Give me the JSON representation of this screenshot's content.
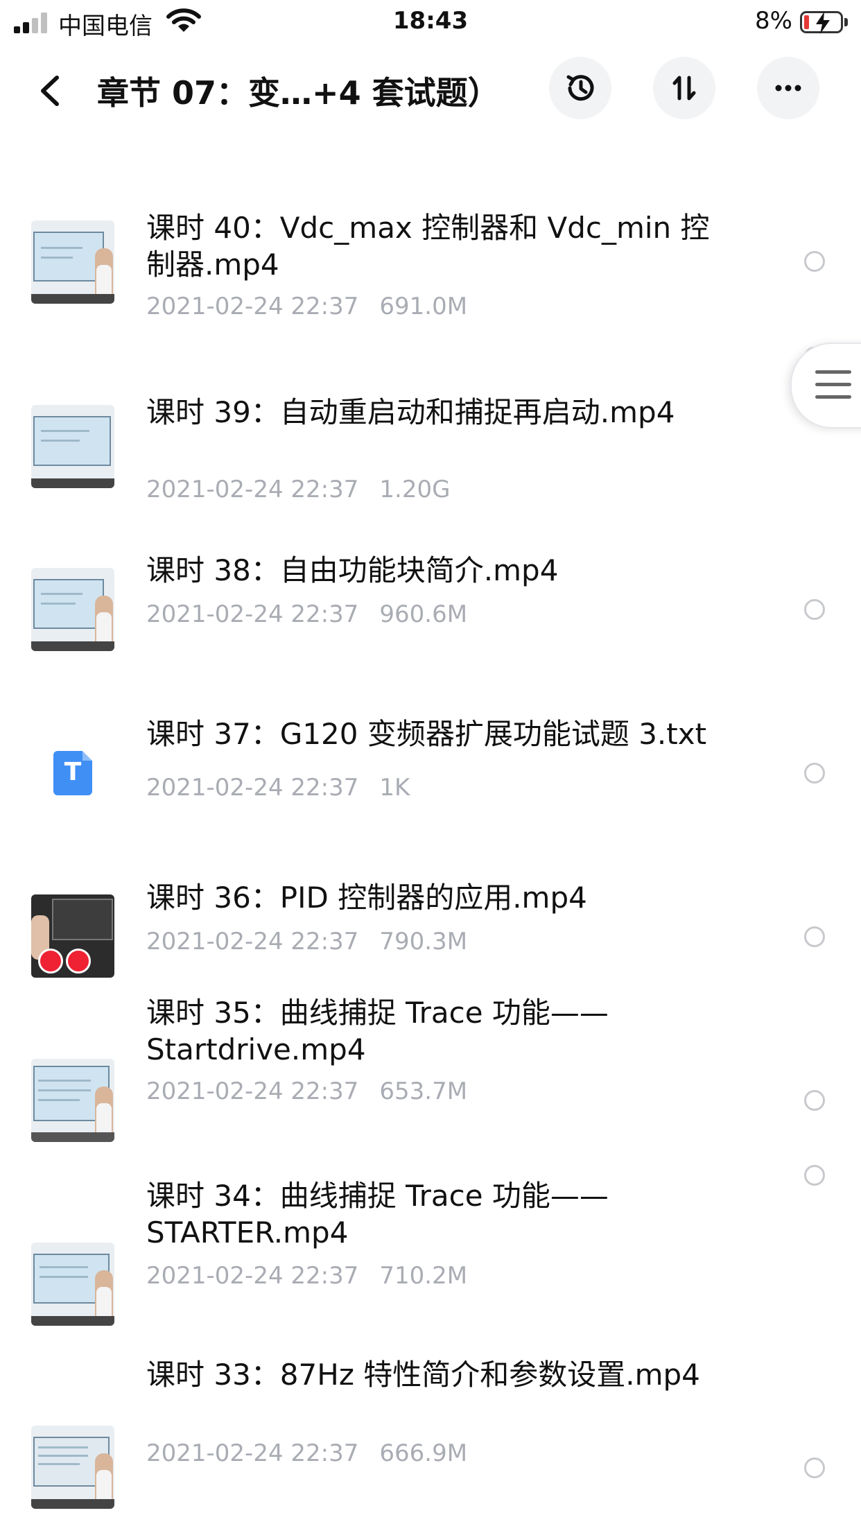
{
  "status_bar": {
    "carrier": "中国电信",
    "time": "18:43",
    "battery_percent": "8%",
    "battery_color": "#e53935"
  },
  "header": {
    "title": "章节 07：变…+4 套试题）",
    "back_icon": "chevron-left-icon",
    "history_icon": "history-icon",
    "sort_icon": "sort-icon",
    "more_icon": "more-dots-icon"
  },
  "side_menu": {
    "icon": "menu-lines-icon"
  },
  "files": [
    {
      "name": "课时 40：Vdc_max 控制器和 Vdc_min 控制器.mp4",
      "date": "2021-02-24 22:37",
      "size": "691.0M",
      "kind": "video"
    },
    {
      "name": "课时 39：自动重启动和捕捉再启动.mp4",
      "date": "2021-02-24 22:37",
      "size": "1.20G",
      "kind": "video"
    },
    {
      "name": "课时 38：自由功能块简介.mp4",
      "date": "2021-02-24 22:37",
      "size": "960.6M",
      "kind": "video"
    },
    {
      "name": "课时 37：G120 变频器扩展功能试题 3.txt",
      "date": "2021-02-24 22:37",
      "size": "1K",
      "kind": "txt",
      "icon_letter": "T",
      "icon_color": "#3f8ff5"
    },
    {
      "name": "课时 36：PID 控制器的应用.mp4",
      "date": "2021-02-24 22:37",
      "size": "790.3M",
      "kind": "video"
    },
    {
      "name": "课时 35：曲线捕捉 Trace 功能——Startdrive.mp4",
      "date": "2021-02-24 22:37",
      "size": "653.7M",
      "kind": "video"
    },
    {
      "name": "课时 34：曲线捕捉 Trace 功能——STARTER.mp4",
      "date": "2021-02-24 22:37",
      "size": "710.2M",
      "kind": "video"
    },
    {
      "name": "课时 33：87Hz 特性简介和参数设置.mp4",
      "date": "2021-02-24 22:37",
      "size": "666.9M",
      "kind": "video"
    }
  ]
}
